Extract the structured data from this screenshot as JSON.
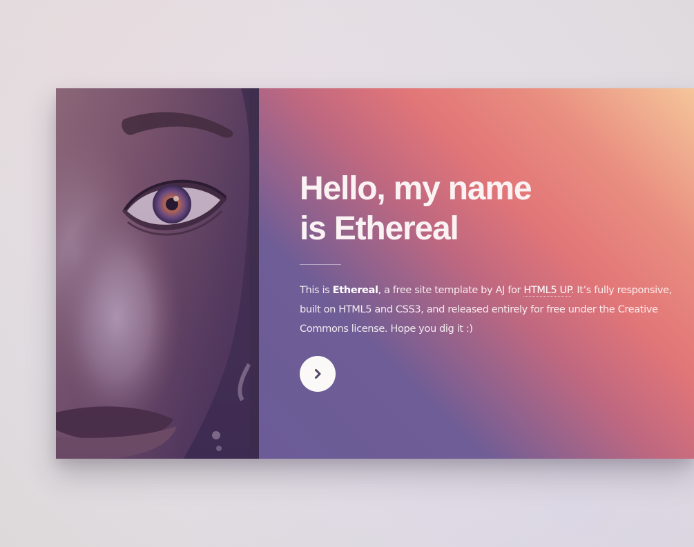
{
  "intro": {
    "heading_line1": "Hello, my name",
    "heading_line2": "is Ethereal",
    "text_before_name": "This is ",
    "site_name": "Ethereal",
    "text_after_name": ", a free site template by AJ for ",
    "link_label": "HTML5 UP",
    "text_after_link": ". It’s fully responsive, built on HTML5 and CSS3, and released entirely for free under the Creative Commons license. Hope you dig it :)",
    "next_icon": "chevron-right-icon"
  },
  "colors": {
    "gradient_violet": "#6b5b97",
    "gradient_coral": "#e27678",
    "gradient_peach": "#f5c59a",
    "heading_text": "#fbf3f3",
    "button_bg": "#fbf8f8",
    "button_icon": "#4e4365"
  }
}
